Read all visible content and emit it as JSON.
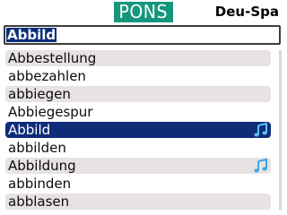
{
  "header": {
    "logo_text": "PONS",
    "language_pair": "Deu-Spa"
  },
  "search": {
    "value": "Abbild"
  },
  "results": [
    {
      "word": "Abbestellung",
      "audio": false
    },
    {
      "word": "abbezahlen",
      "audio": false
    },
    {
      "word": "abbiegen",
      "audio": false
    },
    {
      "word": "Abbiegespur",
      "audio": false
    },
    {
      "word": "Abbild",
      "audio": true,
      "selected": true
    },
    {
      "word": "abbilden",
      "audio": false
    },
    {
      "word": "Abbildung",
      "audio": true
    },
    {
      "word": "abbinden",
      "audio": false
    },
    {
      "word": "abblasen",
      "audio": false
    }
  ],
  "icons": {
    "audio": "music-note-icon"
  },
  "colors": {
    "logo_bg": "#14967d",
    "selection": "#0f2c77",
    "alt_row": "#e7e2e4",
    "note": "#3aa7e6"
  }
}
